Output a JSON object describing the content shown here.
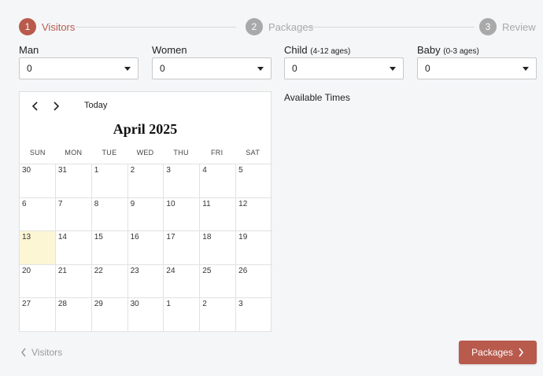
{
  "stepper": {
    "steps": [
      {
        "number": "1",
        "label": "Visitors"
      },
      {
        "number": "2",
        "label": "Packages"
      },
      {
        "number": "3",
        "label": "Review"
      }
    ]
  },
  "visitors": {
    "man": {
      "label": "Man",
      "value": "0"
    },
    "women": {
      "label": "Women",
      "value": "0"
    },
    "child": {
      "label": "Child",
      "note": "(4-12 ages)",
      "value": "0"
    },
    "baby": {
      "label": "Baby",
      "note": "(0-3 ages)",
      "value": "0"
    }
  },
  "calendar": {
    "today_label": "Today",
    "title": "April 2025",
    "weekdays": [
      "SUN",
      "MON",
      "TUE",
      "WED",
      "THU",
      "FRI",
      "SAT"
    ],
    "days": [
      "30",
      "31",
      "1",
      "2",
      "3",
      "4",
      "5",
      "6",
      "7",
      "8",
      "9",
      "10",
      "11",
      "12",
      "13",
      "14",
      "15",
      "16",
      "17",
      "18",
      "19",
      "20",
      "21",
      "22",
      "23",
      "24",
      "25",
      "26",
      "27",
      "28",
      "29",
      "30",
      "1",
      "2",
      "3"
    ],
    "highlighted_day_index": 14,
    "highlight_color": "#fdf6d4"
  },
  "available_times_label": "Available Times",
  "footer": {
    "back_label": "Visitors",
    "next_label": "Packages"
  },
  "colors": {
    "accent": "#b85a4c",
    "inactive": "#a9a9a9"
  }
}
